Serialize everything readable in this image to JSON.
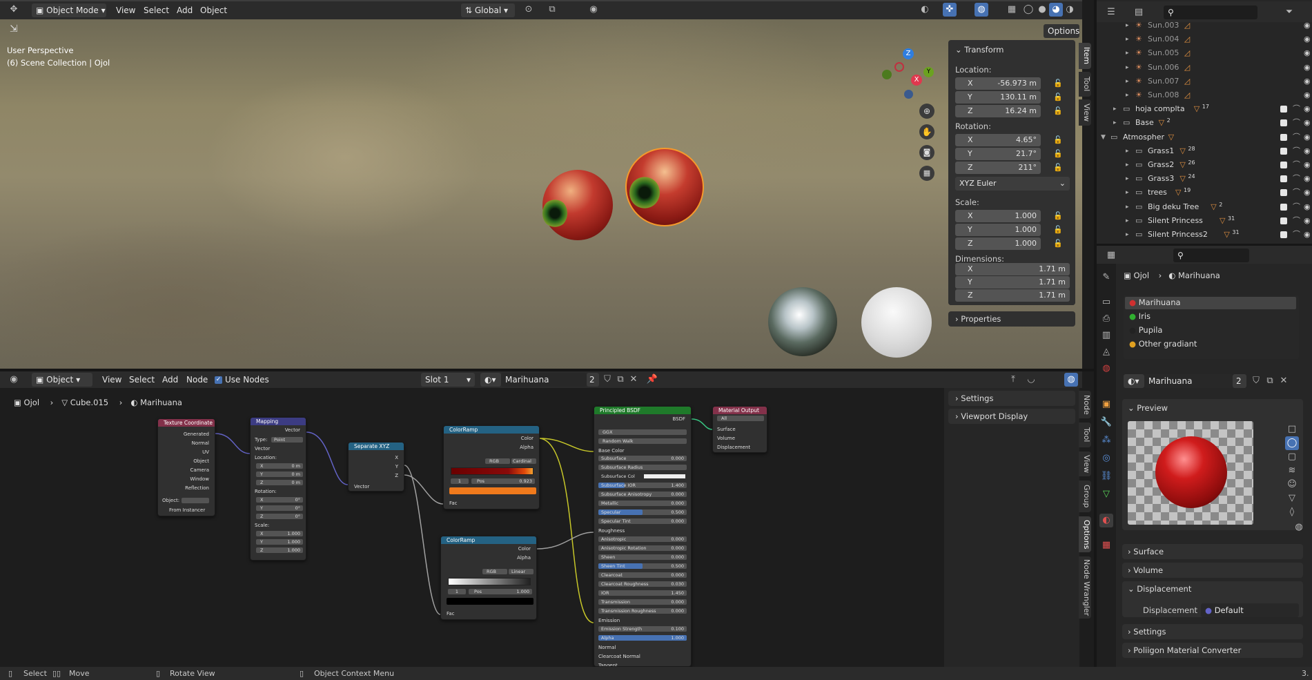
{
  "viewport": {
    "mode": "Object Mode",
    "menus": [
      "View",
      "Select",
      "Add",
      "Object"
    ],
    "orientation": "Global",
    "options": "Options",
    "perspective": "User Perspective",
    "collection": "(6) Scene Collection | Ojol",
    "gizmo": {
      "z": "Z",
      "y": "Y",
      "x": "X"
    },
    "npanel": {
      "transform": "Transform",
      "location_label": "Location:",
      "location": [
        {
          "axis": "X",
          "value": "-56.973 m"
        },
        {
          "axis": "Y",
          "value": "130.11 m"
        },
        {
          "axis": "Z",
          "value": "16.24 m"
        }
      ],
      "rotation_label": "Rotation:",
      "rotation": [
        {
          "axis": "X",
          "value": "4.65°"
        },
        {
          "axis": "Y",
          "value": "21.7°"
        },
        {
          "axis": "Z",
          "value": "211°"
        }
      ],
      "rotation_mode": "XYZ Euler",
      "scale_label": "Scale:",
      "scale": [
        {
          "axis": "X",
          "value": "1.000"
        },
        {
          "axis": "Y",
          "value": "1.000"
        },
        {
          "axis": "Z",
          "value": "1.000"
        }
      ],
      "dimensions_label": "Dimensions:",
      "dimensions": [
        {
          "axis": "X",
          "value": "1.71 m"
        },
        {
          "axis": "Y",
          "value": "1.71 m"
        },
        {
          "axis": "Z",
          "value": "1.71 m"
        }
      ],
      "properties": "Properties"
    },
    "tabs": [
      "Item",
      "Tool",
      "View"
    ]
  },
  "node_editor": {
    "type": "Object",
    "menus": [
      "View",
      "Select",
      "Add",
      "Node"
    ],
    "use_nodes": "Use Nodes",
    "slot": "Slot 1",
    "material": "Marihuana",
    "users": "2",
    "breadcrumb": [
      "Ojol",
      "Cube.015",
      "Marihuana"
    ],
    "sidebar": {
      "settings": "Settings",
      "viewport_display": "Viewport Display"
    },
    "tabs": [
      "Node",
      "Tool",
      "View",
      "Group",
      "Options",
      "Node Wrangler"
    ],
    "nodes": {
      "texcoord": {
        "title": "Texture Coordinate",
        "outputs": [
          "Generated",
          "Normal",
          "UV",
          "Object",
          "Camera",
          "Window",
          "Reflection"
        ],
        "object": "Object:",
        "instancer": "From Instancer"
      },
      "mapping": {
        "title": "Mapping",
        "out": "Vector",
        "type_label": "Type:",
        "type": "Point",
        "vector": "Vector",
        "location": "Location:",
        "rotation": "Rotation:",
        "scale": "Scale:",
        "loc": [
          {
            "a": "X",
            "v": "0 m"
          },
          {
            "a": "Y",
            "v": "0 m"
          },
          {
            "a": "Z",
            "v": "0 m"
          }
        ],
        "rot": [
          {
            "a": "X",
            "v": "0°"
          },
          {
            "a": "Y",
            "v": "0°"
          },
          {
            "a": "Z",
            "v": "0°"
          }
        ],
        "scl": [
          {
            "a": "X",
            "v": "1.000"
          },
          {
            "a": "Y",
            "v": "1.000"
          },
          {
            "a": "Z",
            "v": "1.000"
          }
        ]
      },
      "separate": {
        "title": "Separate XYZ",
        "x": "X",
        "y": "Y",
        "z": "Z",
        "vector": "Vector"
      },
      "ramp1": {
        "title": "ColorRamp",
        "color": "Color",
        "alpha": "Alpha",
        "mode": "RGB",
        "interp": "Cardinal",
        "index": "1",
        "pos_label": "Pos",
        "pos": "0.923",
        "fac": "Fac"
      },
      "ramp2": {
        "title": "ColorRamp",
        "color": "Color",
        "alpha": "Alpha",
        "mode": "RGB",
        "interp": "Linear",
        "index": "1",
        "pos_label": "Pos",
        "pos": "1.000",
        "fac": "Fac"
      },
      "bsdf": {
        "title": "Principled BSDF",
        "out": "BSDF",
        "dist": "GGX",
        "sss": "Random Walk",
        "base": "Base Color",
        "rows": [
          {
            "l": "Subsurface",
            "v": "0.000"
          },
          {
            "l": "Subsurface Radius",
            "v": ""
          },
          {
            "l": "Subsurface Col",
            "v": ""
          },
          {
            "l": "Subsurface IOR",
            "v": "1.400"
          },
          {
            "l": "Subsurface Anisotropy",
            "v": "0.000"
          },
          {
            "l": "Metallic",
            "v": "0.000"
          },
          {
            "l": "Specular",
            "v": "0.500"
          },
          {
            "l": "Specular Tint",
            "v": "0.000"
          },
          {
            "l": "Roughness",
            "v": ""
          },
          {
            "l": "Anisotropic",
            "v": "0.000"
          },
          {
            "l": "Anisotropic Rotation",
            "v": "0.000"
          },
          {
            "l": "Sheen",
            "v": "0.000"
          },
          {
            "l": "Sheen Tint",
            "v": "0.500"
          },
          {
            "l": "Clearcoat",
            "v": "0.000"
          },
          {
            "l": "Clearcoat Roughness",
            "v": "0.030"
          },
          {
            "l": "IOR",
            "v": "1.450"
          },
          {
            "l": "Transmission",
            "v": "0.000"
          },
          {
            "l": "Transmission Roughness",
            "v": "0.000"
          },
          {
            "l": "Emission",
            "v": ""
          },
          {
            "l": "Emission Strength",
            "v": "0.100"
          },
          {
            "l": "Alpha",
            "v": "1.000"
          },
          {
            "l": "Normal",
            "v": ""
          },
          {
            "l": "Clearcoat Normal",
            "v": ""
          },
          {
            "l": "Tangent",
            "v": ""
          }
        ]
      },
      "output": {
        "title": "Material Output",
        "target": "All",
        "surface": "Surface",
        "volume": "Volume",
        "displacement": "Displacement"
      }
    }
  },
  "outliner": {
    "items": [
      {
        "name": "Sun.003",
        "indent": 2,
        "count": ""
      },
      {
        "name": "Sun.004",
        "indent": 2,
        "count": ""
      },
      {
        "name": "Sun.005",
        "indent": 2,
        "count": ""
      },
      {
        "name": "Sun.006",
        "indent": 2,
        "count": ""
      },
      {
        "name": "Sun.007",
        "indent": 2,
        "count": ""
      },
      {
        "name": "Sun.008",
        "indent": 2,
        "count": ""
      },
      {
        "name": "hoja complta",
        "indent": 1,
        "count": "17"
      },
      {
        "name": "Base",
        "indent": 1,
        "count": "2"
      },
      {
        "name": "Atmospher",
        "indent": 0,
        "count": ""
      },
      {
        "name": "Grass1",
        "indent": 2,
        "count": "28"
      },
      {
        "name": "Grass2",
        "indent": 2,
        "count": "26"
      },
      {
        "name": "Grass3",
        "indent": 2,
        "count": "24"
      },
      {
        "name": "trees",
        "indent": 2,
        "count": "19"
      },
      {
        "name": "Big deku Tree",
        "indent": 2,
        "count": "2"
      },
      {
        "name": "Silent Princess",
        "indent": 2,
        "count": "31"
      },
      {
        "name": "Silent Princess2",
        "indent": 2,
        "count": "31"
      }
    ]
  },
  "properties": {
    "breadcrumb": [
      "Ojol",
      "Marihuana"
    ],
    "slots": [
      "Marihuana",
      "Iris",
      "Pupila",
      "Other gradiant"
    ],
    "material": "Marihuana",
    "users": "2",
    "sections": {
      "preview": "Preview",
      "surface": "Surface",
      "volume": "Volume",
      "displacement": "Displacement",
      "displacement_label": "Displacement",
      "displacement_value": "Default",
      "settings": "Settings",
      "converter": "Poliigon Material Converter"
    }
  },
  "status": {
    "select": "Select",
    "move": "Move",
    "rotate": "Rotate View",
    "context": "Object Context Menu",
    "version": "3."
  }
}
